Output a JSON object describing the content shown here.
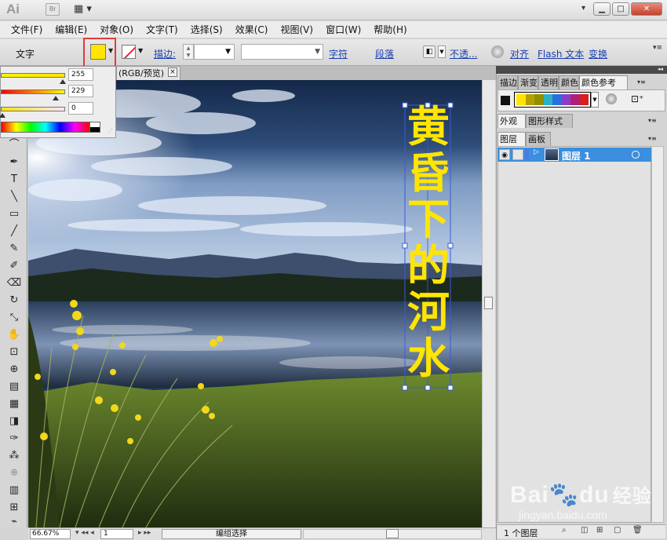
{
  "app": {
    "logo": "Ai",
    "bridge_label": "Br",
    "arrange_icon": "arrange-documents-icon",
    "workspace_dropdown": "▾"
  },
  "menu": [
    "文件(F)",
    "编辑(E)",
    "对象(O)",
    "文字(T)",
    "选择(S)",
    "效果(C)",
    "视图(V)",
    "窗口(W)",
    "帮助(H)"
  ],
  "control_bar": {
    "label": "文字",
    "fill_color": "#ffe500",
    "stroke_label": "描边:",
    "character_link": "字符",
    "paragraph_link": "段落",
    "opacity_link": "不透...",
    "align_link": "对齐",
    "flash_link": "Flash 文本",
    "transform_link": "变换"
  },
  "color_panel": {
    "r": "255",
    "g": "229",
    "b": "0"
  },
  "document": {
    "tab_title": "(RGB/预览)",
    "close_glyph": "×"
  },
  "canvas": {
    "vertical_text": [
      "黄",
      "昏",
      "下",
      "的",
      "河",
      "水"
    ],
    "text_color": "#ffe500"
  },
  "status_bar": {
    "zoom": "66.67%",
    "page": "1",
    "status": "编组选择"
  },
  "right_panel": {
    "top_tabs": [
      "描边",
      "渐变",
      "透明",
      "颜色",
      "颜色参考"
    ],
    "guide_colors": [
      "#ffe500",
      "#b89f00",
      "#8f8f00",
      "#2bb1c4",
      "#2a6fe0",
      "#8b3cc7",
      "#b0207a",
      "#d62020"
    ],
    "appearance_tabs": [
      "外观",
      "图形样式"
    ],
    "layers_tabs": [
      "图层",
      "画板"
    ],
    "layer_name": "图层 1",
    "layer_count": "1 个图层"
  },
  "watermark": {
    "logo_a": "Bai",
    "logo_b": "du",
    "logo_c": "经验",
    "url": "jingyan.baidu.com"
  }
}
